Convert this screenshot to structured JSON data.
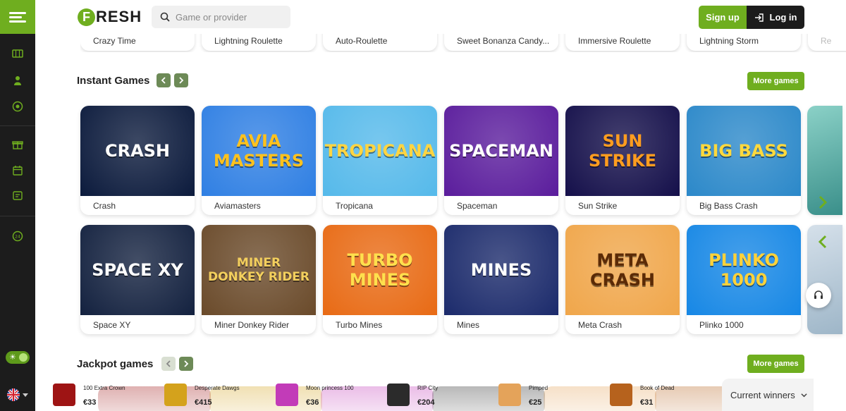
{
  "header": {
    "logo_letter": "F",
    "logo_text": "RESH",
    "search_placeholder": "Game or provider",
    "signup_label": "Sign up",
    "login_label": "Log in"
  },
  "live_strip": [
    "Crazy Time",
    "Lightning Roulette",
    "Auto-Roulette",
    "Sweet Bonanza Candy...",
    "Immersive Roulette",
    "Lightning Storm",
    "Re"
  ],
  "instant": {
    "title": "Instant Games",
    "more_label": "More games",
    "row1": [
      {
        "name": "Crash",
        "art": "CRASH",
        "bg": "#0b1a3c",
        "fg": "#ffffff"
      },
      {
        "name": "Aviamasters",
        "art": "AVIA MASTERS",
        "bg": "#2f7fe3",
        "fg": "#ffc21d"
      },
      {
        "name": "Tropicana",
        "art": "TROPICANA",
        "bg": "#55b9ea",
        "fg": "#ffd541"
      },
      {
        "name": "Spaceman",
        "art": "SPACEMAN",
        "bg": "#5a1c9c",
        "fg": "#ffffff"
      },
      {
        "name": "Sun Strike",
        "art": "SUN STRIKE",
        "bg": "#140f4a",
        "fg": "#ff9d1f"
      },
      {
        "name": "Big Bass Crash",
        "art": "BIG BASS",
        "bg": "#2b88c9",
        "fg": "#ffd93d"
      }
    ],
    "row2": [
      {
        "name": "Space XY",
        "art": "SPACE XY",
        "bg": "#13213f",
        "fg": "#ffffff"
      },
      {
        "name": "Miner Donkey Rider",
        "art": "MINER DONKEY RIDER",
        "bg": "#6a4a2a",
        "fg": "#f3cf5d"
      },
      {
        "name": "Turbo Mines",
        "art": "TURBO MINES",
        "bg": "#e86a14",
        "fg": "#ffe04d"
      },
      {
        "name": "Mines",
        "art": "MINES",
        "bg": "#1b2a6b",
        "fg": "#ffffff"
      },
      {
        "name": "Meta Crash",
        "art": "META CRASH",
        "bg": "#f0a64a",
        "fg": "#5b2a06"
      },
      {
        "name": "Plinko 1000",
        "art": "PLINKO 1000",
        "bg": "#1687e5",
        "fg": "#ffd23a"
      }
    ]
  },
  "jackpot": {
    "title": "Jackpot games",
    "more_label": "More games",
    "winners_label": "Current winners",
    "items": [
      {
        "name": "100 Extra Crown",
        "amount": "€33",
        "color": "#9e1414"
      },
      {
        "name": "Desperate Dawgs",
        "amount": "€415",
        "color": "#d4a21c"
      },
      {
        "name": "Moon princess 100",
        "amount": "€36",
        "color": "#c23bb8"
      },
      {
        "name": "RIP City",
        "amount": "€204",
        "color": "#2b2b2b"
      },
      {
        "name": "Pimped",
        "amount": "€25",
        "color": "#e4a35a"
      },
      {
        "name": "Book of Dead",
        "amount": "€31",
        "color": "#b6621d"
      }
    ]
  },
  "colors": {
    "accent": "#6fae1f",
    "sidebar": "#1c1c1c"
  }
}
